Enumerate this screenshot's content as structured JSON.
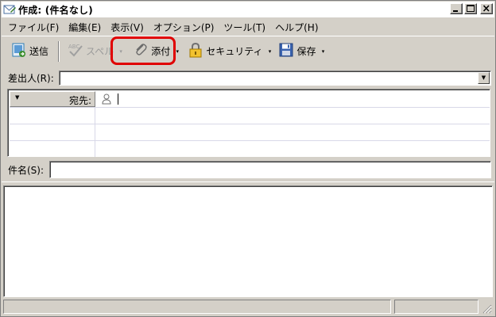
{
  "window": {
    "title": "作成: (件名なし)",
    "controls": {
      "minimize": "_",
      "maximize": "□",
      "close": "×"
    }
  },
  "menubar": {
    "items": [
      {
        "label": "ファイル(F)"
      },
      {
        "label": "編集(E)"
      },
      {
        "label": "表示(V)"
      },
      {
        "label": "オプション(P)"
      },
      {
        "label": "ツール(T)"
      },
      {
        "label": "ヘルプ(H)"
      }
    ]
  },
  "toolbar": {
    "send_label": "送信",
    "spell_label": "スペル",
    "attach_label": "添付",
    "security_label": "セキュリティ",
    "save_label": "保存",
    "dropdown_glyph": "▾"
  },
  "compose": {
    "from_label": "差出人(R):",
    "from_value": "",
    "recipient_type": "宛先:",
    "recipient_value": "",
    "subject_label": "件名(S):",
    "subject_value": "",
    "body": ""
  },
  "colors": {
    "chrome": "#d4d0c8",
    "highlight": "#e00000",
    "send_icon": "#2d7db6"
  }
}
